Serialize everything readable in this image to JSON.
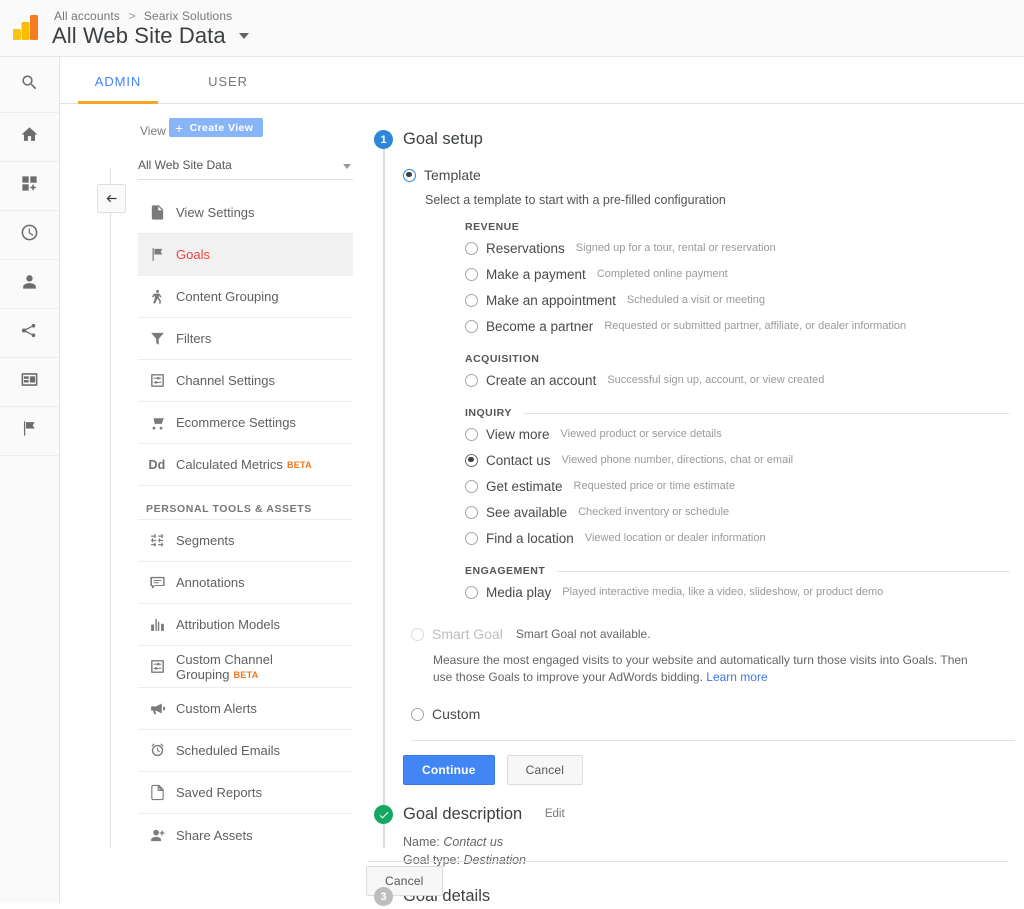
{
  "header": {
    "breadcrumb": {
      "account": "All accounts",
      "separator": ">",
      "property": "Searix Solutions"
    },
    "view_title": "All Web Site Data",
    "logo_icon": "google-analytics-logo"
  },
  "tabs": [
    {
      "label": "ADMIN",
      "selected": true
    },
    {
      "label": "USER",
      "selected": false
    }
  ],
  "rail": {
    "items": [
      {
        "icon": "search-icon"
      },
      {
        "icon": "home-icon"
      },
      {
        "icon": "customization-icon"
      },
      {
        "icon": "realtime-clock-icon"
      },
      {
        "icon": "audience-person-icon"
      },
      {
        "icon": "acquisition-share-icon"
      },
      {
        "icon": "behavior-window-icon"
      },
      {
        "icon": "conversions-flag-icon"
      }
    ]
  },
  "view_panel": {
    "column_label": "View",
    "create_button": "Create View",
    "create_button_color": "#8ab4f8",
    "selected_view": "All Web Site Data",
    "collapse_icon": "back-arrow-icon",
    "menu": [
      {
        "label": "View Settings",
        "icon": "document-icon",
        "active": false,
        "beta": ""
      },
      {
        "label": "Goals",
        "icon": "flag-icon",
        "active": true,
        "beta": ""
      },
      {
        "label": "Content Grouping",
        "icon": "person-walking-icon",
        "active": false,
        "beta": ""
      },
      {
        "label": "Filters",
        "icon": "funnel-icon",
        "active": false,
        "beta": ""
      },
      {
        "label": "Channel Settings",
        "icon": "channel-settings-icon",
        "active": false,
        "beta": ""
      },
      {
        "label": "Ecommerce Settings",
        "icon": "shopping-cart-icon",
        "active": false,
        "beta": ""
      },
      {
        "label": "Calculated Metrics",
        "icon": "dd-text-icon",
        "active": false,
        "beta": "BETA"
      }
    ],
    "personal_section_label": "PERSONAL TOOLS & ASSETS",
    "personal_menu": [
      {
        "label": "Segments",
        "icon": "segments-icon",
        "active": false,
        "beta": ""
      },
      {
        "label": "Annotations",
        "icon": "annotation-bubble-icon",
        "active": false,
        "beta": ""
      },
      {
        "label": "Attribution Models",
        "icon": "bar-chart-icon",
        "active": false,
        "beta": ""
      },
      {
        "label": "Custom Channel Grouping",
        "icon": "channel-settings-icon",
        "active": false,
        "beta": "BETA"
      },
      {
        "label": "Custom Alerts",
        "icon": "megaphone-icon",
        "active": false,
        "beta": ""
      },
      {
        "label": "Scheduled Emails",
        "icon": "alarm-clock-icon",
        "active": false,
        "beta": ""
      },
      {
        "label": "Saved Reports",
        "icon": "page-icon",
        "active": false,
        "beta": ""
      },
      {
        "label": "Share Assets",
        "icon": "person-add-icon",
        "active": false,
        "beta": ""
      }
    ],
    "beta_color": "#f0761a",
    "active_color": "#e8453c"
  },
  "goal_setup": {
    "step_number": "1",
    "title": "Goal setup",
    "template_option": "Template",
    "template_selected": true,
    "template_hint": "Select a template to start with a pre-filled configuration",
    "categories": [
      {
        "name": "REVENUE",
        "divider": false,
        "options": [
          {
            "name": "Reservations",
            "desc": "Signed up for a tour, rental or reservation",
            "selected": false
          },
          {
            "name": "Make a payment",
            "desc": "Completed online payment",
            "selected": false
          },
          {
            "name": "Make an appointment",
            "desc": "Scheduled a visit or meeting",
            "selected": false
          },
          {
            "name": "Become a partner",
            "desc": "Requested or submitted partner, affiliate, or dealer information",
            "selected": false
          }
        ]
      },
      {
        "name": "ACQUISITION",
        "divider": false,
        "options": [
          {
            "name": "Create an account",
            "desc": "Successful sign up, account, or view created",
            "selected": false
          }
        ]
      },
      {
        "name": "INQUIRY",
        "divider": true,
        "options": [
          {
            "name": "View more",
            "desc": "Viewed product or service details",
            "selected": false
          },
          {
            "name": "Contact us",
            "desc": "Viewed phone number, directions, chat or email",
            "selected": true
          },
          {
            "name": "Get estimate",
            "desc": "Requested price or time estimate",
            "selected": false
          },
          {
            "name": "See available",
            "desc": "Checked inventory or schedule",
            "selected": false
          },
          {
            "name": "Find a location",
            "desc": "Viewed location or dealer information",
            "selected": false
          }
        ]
      },
      {
        "name": "ENGAGEMENT",
        "divider": true,
        "options": [
          {
            "name": "Media play",
            "desc": "Played interactive media, like a video, slideshow, or product demo",
            "selected": false
          }
        ]
      }
    ],
    "smart_goal": {
      "name": "Smart Goal",
      "availability": "Smart Goal not available.",
      "description": "Measure the most engaged visits to your website and automatically turn those visits into Goals. Then use those Goals to improve your AdWords bidding.",
      "learn_more": "Learn more",
      "disabled": true
    },
    "custom_option": "Custom",
    "continue_button": "Continue",
    "cancel_button": "Cancel"
  },
  "goal_description": {
    "step_number": "2",
    "status": "done",
    "title": "Goal description",
    "edit_link": "Edit",
    "name_label": "Name:",
    "name_value": "Contact us",
    "type_label": "Goal type:",
    "type_value": "Destination"
  },
  "goal_details": {
    "step_number": "3",
    "title": "Goal details"
  },
  "footer": {
    "cancel_button": "Cancel"
  }
}
